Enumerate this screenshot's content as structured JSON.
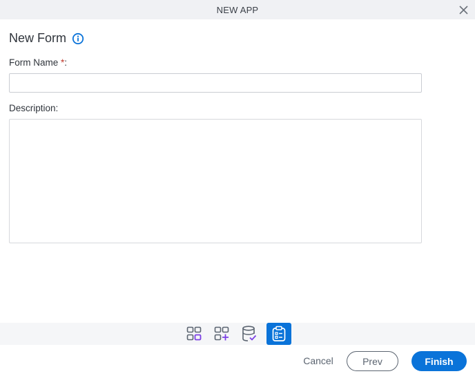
{
  "window": {
    "title": "NEW APP",
    "close_icon": "close-icon"
  },
  "form": {
    "heading": "New Form",
    "info_icon": "info-icon",
    "name_label": "Form Name",
    "required_marker": "*",
    "name_suffix": ":",
    "name_value": "",
    "description_label": "Description:",
    "description_value": ""
  },
  "steps": [
    {
      "icon": "app-grid-icon",
      "active": false
    },
    {
      "icon": "grid-add-icon",
      "active": false
    },
    {
      "icon": "database-check-icon",
      "active": false
    },
    {
      "icon": "clipboard-form-icon",
      "active": true
    }
  ],
  "footer": {
    "cancel_label": "Cancel",
    "prev_label": "Prev",
    "finish_label": "Finish"
  },
  "colors": {
    "accent": "#0a73d9",
    "step_accent": "#7b3fe4",
    "required": "#c0392b"
  }
}
